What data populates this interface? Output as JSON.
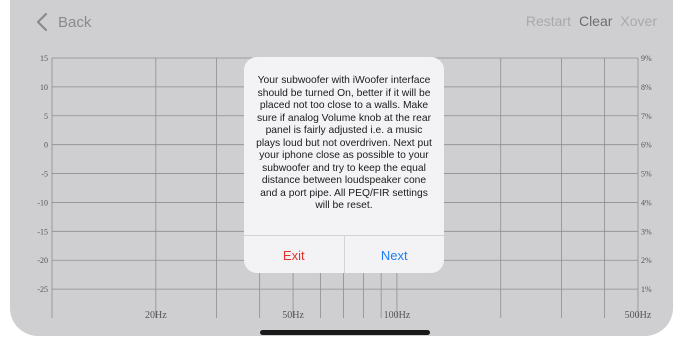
{
  "nav": {
    "back_label": "Back",
    "actions": {
      "restart": "Restart",
      "clear": "Clear",
      "xover": "Xover"
    }
  },
  "chart_data": {
    "type": "line",
    "x_scale": "log",
    "xlim": [
      10,
      500
    ],
    "ylim": [
      -30,
      15
    ],
    "y_left_ticks": [
      "15",
      "10",
      "5",
      "0",
      "-5",
      "-10",
      "-15",
      "-20",
      "-25"
    ],
    "y_left_values": [
      15,
      10,
      5,
      0,
      -5,
      -10,
      -15,
      -20,
      -25
    ],
    "y_right_ticks": [
      "9%",
      "8%",
      "7%",
      "6%",
      "5%",
      "4%",
      "3%",
      "2%",
      "1%"
    ],
    "x_ticks": [
      "20Hz",
      "50Hz",
      "100Hz",
      "500Hz"
    ],
    "x_tick_values": [
      20,
      50,
      100,
      500
    ],
    "x_grid": [
      20,
      30,
      40,
      50,
      60,
      70,
      80,
      90,
      100,
      200,
      300,
      400,
      500
    ],
    "grid": true,
    "series": []
  },
  "dialog": {
    "message": "Your subwoofer with iWoofer interface should be turned On, better if it will be placed not too close to a walls. Make sure if analog Volume knob at the rear panel is fairly adjusted i.e. a music plays loud but not overdriven. Next put your iphone close as possible to your subwoofer and try to keep the equal distance between loudspeaker cone and a port pipe. All PEQ/FIR settings will be reset.",
    "exit_label": "Exit",
    "next_label": "Next"
  },
  "colors": {
    "background": "#cfcfd1",
    "grid": "#8e8e91",
    "exit": "#e0352b",
    "next": "#1f7ef2"
  }
}
